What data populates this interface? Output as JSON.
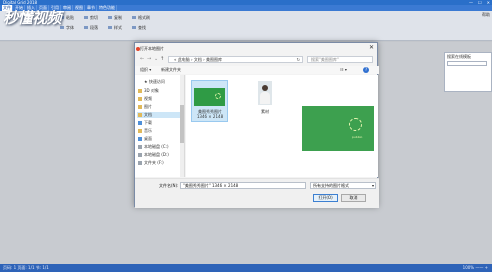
{
  "app": {
    "title": "Digital Grid 2018",
    "window_controls": [
      "—",
      "☐",
      "✕"
    ],
    "menu": [
      {
        "label": "文件",
        "active": true
      },
      {
        "label": "开始"
      },
      {
        "label": "插入"
      },
      {
        "label": "页面"
      },
      {
        "label": "引用"
      },
      {
        "label": "审阅"
      },
      {
        "label": "视图"
      },
      {
        "label": "章节"
      },
      {
        "label": "特色功能"
      }
    ],
    "help_link": "帮助",
    "side_panel_title": "搜索在线模板",
    "logo_text": "秒懂视频",
    "status_text": "页码: 1  页面: 1/1  节: 1/1",
    "zoom_text": "100% —— +"
  },
  "ribbon_buttons": [
    {
      "label": "粘贴"
    },
    {
      "label": "剪切"
    },
    {
      "label": "复制"
    },
    {
      "label": "格式刷"
    },
    {
      "label": "字体"
    },
    {
      "label": "段落"
    },
    {
      "label": "样式"
    },
    {
      "label": "查找"
    }
  ],
  "dialog": {
    "title": "打开本地图片",
    "close_icon": "close-icon",
    "nav": {
      "back": "←",
      "forward": "→",
      "up": "↑",
      "recent": "⌄"
    },
    "breadcrumb": "« 此电脑 › 文档 › 美图图库",
    "refresh": "↻",
    "search_placeholder": "搜索\"美图图库\"",
    "toolbar": {
      "organize": "组织 ▾",
      "new_folder": "新建文件夹",
      "view": "☷ ▾",
      "help": "?"
    },
    "nav_items": [
      {
        "label": "★ 快速访问",
        "icon": "star-icon"
      },
      {
        "label": "3D 对象",
        "icon": "folder-icon"
      },
      {
        "label": "视频",
        "icon": "video-icon"
      },
      {
        "label": "图片",
        "icon": "picture-icon"
      },
      {
        "label": "文档",
        "icon": "document-icon",
        "selected": true
      },
      {
        "label": "下载",
        "icon": "download-icon"
      },
      {
        "label": "音乐",
        "icon": "music-icon"
      },
      {
        "label": "桌面",
        "icon": "desktop-icon"
      },
      {
        "label": "本地磁盘 (C:)",
        "icon": "drive-icon"
      },
      {
        "label": "本地磁盘 (D:)",
        "icon": "drive-icon"
      },
      {
        "label": "文件夹 (F:)",
        "icon": "drive-icon"
      }
    ],
    "files": [
      {
        "name": "美图秀秀图片",
        "size": "1346 × 2148",
        "selected": true
      },
      {
        "name": "素材"
      }
    ],
    "preview_brand": "pubbio",
    "filename_label": "文件名(N):",
    "filename_value": "\"美图秀秀图片\"  1346 × 2148",
    "filter_value": "所有支持的图片格式",
    "filter_caret": "▾",
    "open_label": "打开(O)",
    "cancel_label": "取消"
  }
}
